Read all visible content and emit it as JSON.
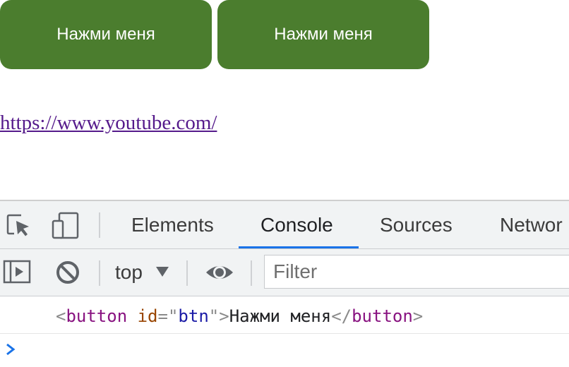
{
  "page": {
    "buttons": [
      {
        "label": "Нажми меня"
      },
      {
        "label": "Нажми меня"
      }
    ],
    "link": {
      "text": "https://www.youtube.com/"
    }
  },
  "devtools": {
    "tabs": [
      {
        "label": "Elements"
      },
      {
        "label": "Console",
        "active": true
      },
      {
        "label": "Sources"
      },
      {
        "label": "Networ"
      }
    ],
    "toolbar": {
      "context": "top",
      "filter_placeholder": "Filter"
    },
    "console": {
      "log": {
        "open_bracket": "<",
        "tag": "button",
        "attr_name": "id",
        "equals": "=",
        "quote": "\"",
        "attr_value": "btn",
        "close_bracket": ">",
        "text": "Нажми меня",
        "end_open": "</",
        "end_tag": "button",
        "end_close": ">"
      }
    },
    "colors": {
      "active_tab_underline": "#1a73e8",
      "button_green": "#4b7d2e",
      "prompt_chevron": "#1a73e8"
    },
    "icons": [
      "inspect-element-icon",
      "device-toolbar-icon",
      "sidebar-toggle-icon",
      "clear-console-icon",
      "dropdown-arrow-icon",
      "live-expression-eye-icon",
      "console-prompt-chevron-icon"
    ]
  }
}
